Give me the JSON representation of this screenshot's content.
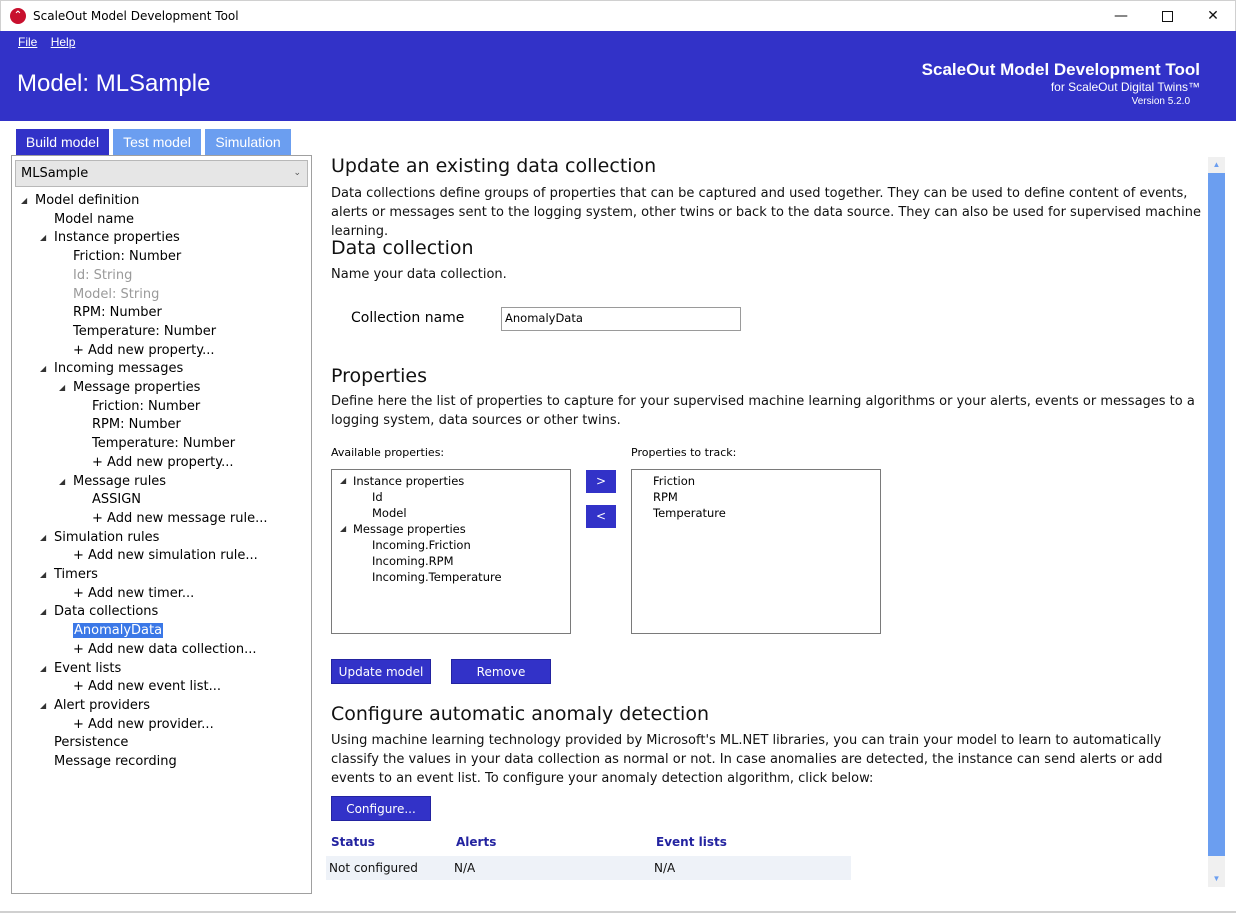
{
  "window": {
    "title": "ScaleOut Model Development Tool",
    "minimize": "—",
    "close": "✕"
  },
  "menu": {
    "file": "File",
    "help": "Help"
  },
  "header": {
    "model_title": "Model: MLSample",
    "brand_title": "ScaleOut Model Development Tool",
    "brand_subtitle": "for ScaleOut Digital Twins™",
    "version": "Version 5.2.0"
  },
  "tabs": {
    "build": "Build model",
    "test": "Test model",
    "simulation": "Simulation"
  },
  "sidebar": {
    "selected_model": "MLSample",
    "tree": [
      {
        "label": "Model definition",
        "level": 0,
        "expander": true
      },
      {
        "label": "Model name",
        "level": 1
      },
      {
        "label": "Instance properties",
        "level": 1,
        "expander": true
      },
      {
        "label": "Friction: Number",
        "level": 2
      },
      {
        "label": "Id: String",
        "level": 2,
        "disabled": true
      },
      {
        "label": "Model: String",
        "level": 2,
        "disabled": true
      },
      {
        "label": "RPM: Number",
        "level": 2
      },
      {
        "label": "Temperature: Number",
        "level": 2
      },
      {
        "label": "+ Add new property...",
        "level": 2
      },
      {
        "label": "Incoming messages",
        "level": 1,
        "expander": true
      },
      {
        "label": "Message properties",
        "level": 2,
        "expander": true
      },
      {
        "label": "Friction: Number",
        "level": 3
      },
      {
        "label": "RPM: Number",
        "level": 3
      },
      {
        "label": "Temperature: Number",
        "level": 3
      },
      {
        "label": "+ Add new property...",
        "level": 3
      },
      {
        "label": "Message rules",
        "level": 2,
        "expander": true
      },
      {
        "label": "ASSIGN",
        "level": 3
      },
      {
        "label": "+ Add new message rule...",
        "level": 3
      },
      {
        "label": "Simulation rules",
        "level": 1,
        "expander": true
      },
      {
        "label": "+ Add new simulation rule...",
        "level": 2
      },
      {
        "label": "Timers",
        "level": 1,
        "expander": true
      },
      {
        "label": "+ Add new timer...",
        "level": 2
      },
      {
        "label": "Data collections",
        "level": 1,
        "expander": true
      },
      {
        "label": "AnomalyData",
        "level": 2,
        "selected": true
      },
      {
        "label": "+ Add new data collection...",
        "level": 2
      },
      {
        "label": "Event lists",
        "level": 1,
        "expander": true
      },
      {
        "label": "+ Add new event list...",
        "level": 2
      },
      {
        "label": "Alert providers",
        "level": 1,
        "expander": true
      },
      {
        "label": "+ Add new provider...",
        "level": 2
      },
      {
        "label": "Persistence",
        "level": 1
      },
      {
        "label": "Message recording",
        "level": 1
      }
    ]
  },
  "main": {
    "heading": "Update an existing data collection",
    "intro": "Data collections define groups of properties that can be captured and used together. They can be used to define content of events, alerts or messages sent to the logging system, other twins or back to the data source. They can also be used for supervised machine learning.",
    "collection_heading": "Data collection",
    "collection_hint": "Name your data collection.",
    "collection_label": "Collection name",
    "collection_value": "AnomalyData",
    "properties_heading": "Properties",
    "properties_intro": "Define here the list of properties to capture for your supervised machine learning algorithms or your alerts, events or messages to a logging system, data sources or other twins.",
    "available_label": "Available properties:",
    "tracked_label": "Properties to track:",
    "available": [
      {
        "label": "Instance properties",
        "level": 0,
        "expander": true
      },
      {
        "label": "Id",
        "level": 1
      },
      {
        "label": "Model",
        "level": 1
      },
      {
        "label": "Message properties",
        "level": 0,
        "expander": true
      },
      {
        "label": "Incoming.Friction",
        "level": 1
      },
      {
        "label": "Incoming.RPM",
        "level": 1
      },
      {
        "label": "Incoming.Temperature",
        "level": 1
      }
    ],
    "tracked": [
      "Friction",
      "RPM",
      "Temperature"
    ],
    "add_arrow": ">",
    "remove_arrow": "<",
    "update_button": "Update model",
    "remove_button": "Remove",
    "anomaly_heading": "Configure automatic anomaly detection",
    "anomaly_intro": "Using machine learning technology provided by Microsoft's ML.NET libraries, you can train your model to learn to automatically classify the values in your data collection as normal or not. In case anomalies are detected, the instance can send alerts or add events to an event list. To configure your anomaly detection algorithm, click below:",
    "configure_button": "Configure...",
    "status_table": {
      "headers": {
        "status": "Status",
        "alerts": "Alerts",
        "events": "Event lists"
      },
      "row": {
        "status": "Not configured",
        "alerts": "N/A",
        "events": "N/A"
      }
    }
  },
  "colors": {
    "brand_blue": "#3232c8",
    "tab_inactive": "#6b9ef0",
    "selection": "#3b78e7"
  }
}
